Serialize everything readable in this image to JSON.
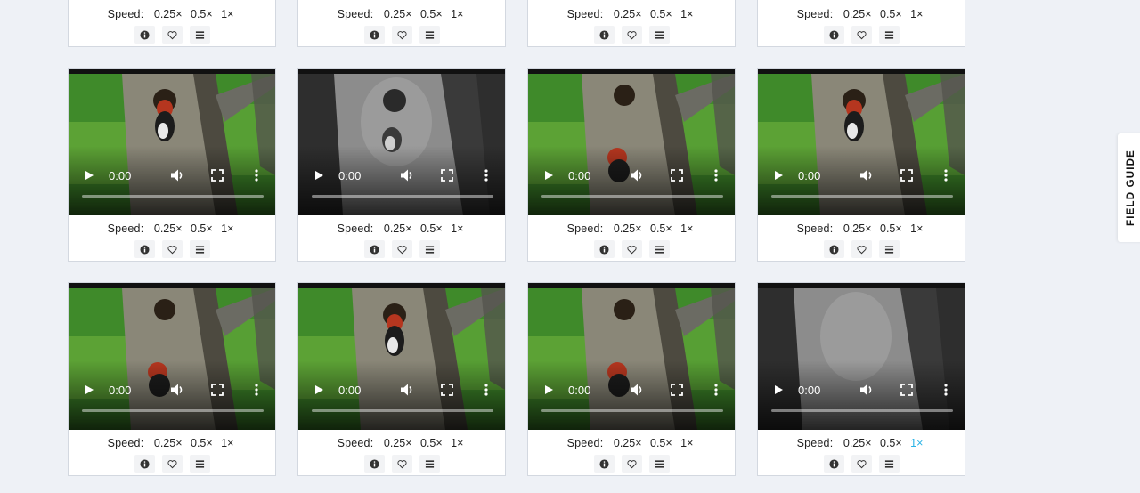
{
  "speed_label": "Speed:",
  "speed_options": [
    "0.25×",
    "0.5×",
    "1×"
  ],
  "player": {
    "time": "0:00"
  },
  "field_guide": {
    "label": "FIELD GUIDE"
  },
  "colors": {
    "accent": "#2ab3e6",
    "page_bg": "#eef1f6",
    "card_border": "#d3d8e0"
  },
  "icons": {
    "info": "info-icon",
    "favorite": "heart-icon",
    "list": "list-icon"
  },
  "cards": [
    {
      "scene": "none"
    },
    {
      "scene": "none"
    },
    {
      "scene": "none"
    },
    {
      "scene": "none"
    },
    {
      "scene": "day",
      "bird": "at-hole"
    },
    {
      "scene": "night",
      "bird": "below-hole"
    },
    {
      "scene": "day",
      "bird": "low"
    },
    {
      "scene": "day",
      "bird": "at-hole"
    },
    {
      "scene": "day",
      "bird": "low"
    },
    {
      "scene": "day",
      "bird": "at-hole"
    },
    {
      "scene": "day",
      "bird": "low"
    },
    {
      "scene": "night",
      "bird": "none",
      "active_speed": 2
    }
  ],
  "row3_col2_active_speed": "1×"
}
